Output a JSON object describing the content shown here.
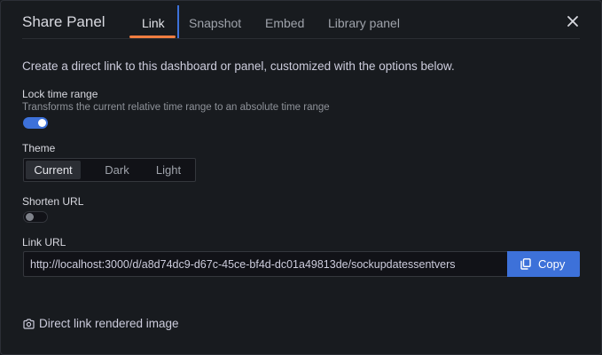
{
  "header": {
    "title": "Share Panel",
    "tabs": [
      {
        "label": "Link",
        "active": true
      },
      {
        "label": "Snapshot",
        "active": false
      },
      {
        "label": "Embed",
        "active": false
      },
      {
        "label": "Library panel",
        "active": false
      }
    ],
    "close_icon": "close-icon"
  },
  "intro": "Create a direct link to this dashboard or panel, customized with the options below.",
  "lock_time_range": {
    "label": "Lock time range",
    "description": "Transforms the current relative time range to an absolute time range",
    "enabled": true
  },
  "theme": {
    "label": "Theme",
    "options": [
      "Current",
      "Dark",
      "Light"
    ],
    "selected": "Current"
  },
  "shorten_url": {
    "label": "Shorten URL",
    "enabled": false
  },
  "link_url": {
    "label": "Link URL",
    "value": "http://localhost:3000/d/a8d74dc9-d67c-45ce-bf4d-dc01a49813de/sockupdatessentvers",
    "copy_label": "Copy",
    "copy_icon": "copy-icon"
  },
  "rendered_image": {
    "label": "Direct link rendered image",
    "icon": "camera-icon"
  },
  "colors": {
    "background": "#181b1f",
    "accent": "#3d71d9",
    "active_tab_underline": "#f07d40",
    "text": "#ccccdc",
    "muted_text": "#8e9299"
  }
}
